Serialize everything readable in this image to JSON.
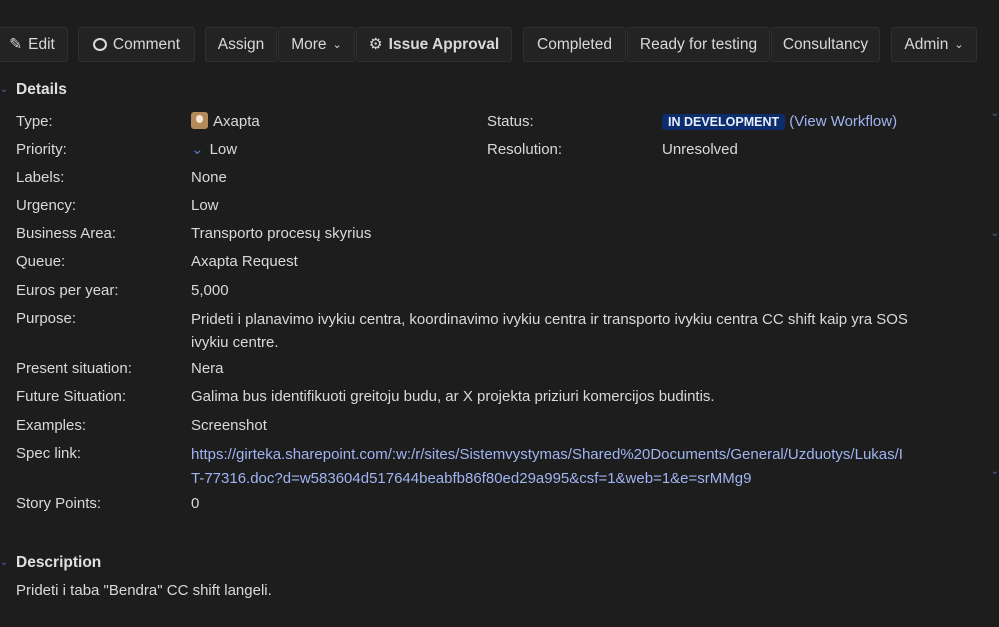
{
  "toolbar": {
    "edit": "Edit",
    "comment": "Comment",
    "assign": "Assign",
    "more": "More",
    "issue_approval": "Issue Approval",
    "completed": "Completed",
    "ready_for_testing": "Ready for testing",
    "consultancy": "Consultancy",
    "admin": "Admin"
  },
  "details": {
    "title": "Details",
    "type_label": "Type:",
    "type_value": "Axapta",
    "priority_label": "Priority:",
    "priority_value": "Low",
    "labels_label": "Labels:",
    "labels_value": "None",
    "urgency_label": "Urgency:",
    "urgency_value": "Low",
    "business_area_label": "Business Area:",
    "business_area_value": "Transporto procesų skyrius",
    "queue_label": "Queue:",
    "queue_value": "Axapta Request",
    "euros_label": "Euros per year:",
    "euros_value": "5,000",
    "purpose_label": "Purpose:",
    "purpose_value": "Prideti i planavimo ivykiu centra, koordinavimo ivykiu centra ir transporto ivykiu centra CC shift kaip yra SOS ivykiu centre.",
    "present_label": "Present situation:",
    "present_value": "Nera",
    "future_label": "Future Situation:",
    "future_value": "Galima bus identifikuoti greitoju budu, ar X projekta priziuri komercijos budintis.",
    "examples_label": "Examples:",
    "examples_value": "Screenshot",
    "spec_label": "Spec link:",
    "spec_value": "https://girteka.sharepoint.com/:w:/r/sites/Sistemvystymas/Shared%20Documents/General/Uzduotys/Lukas/IT-77316.doc?d=w583604d517644beabfb86f80ed29a995&csf=1&web=1&e=srMMg9",
    "story_label": "Story Points:",
    "story_value": "0",
    "status_label": "Status:",
    "status_value": "IN DEVELOPMENT",
    "view_workflow": "View Workflow",
    "resolution_label": "Resolution:",
    "resolution_value": "Unresolved"
  },
  "description": {
    "title": "Description",
    "text": "Prideti i taba \"Bendra\" CC shift langeli."
  },
  "colors": {
    "background": "#1d1d1e",
    "link": "#9fb4f0",
    "lozenge": "#0c2d6b"
  }
}
